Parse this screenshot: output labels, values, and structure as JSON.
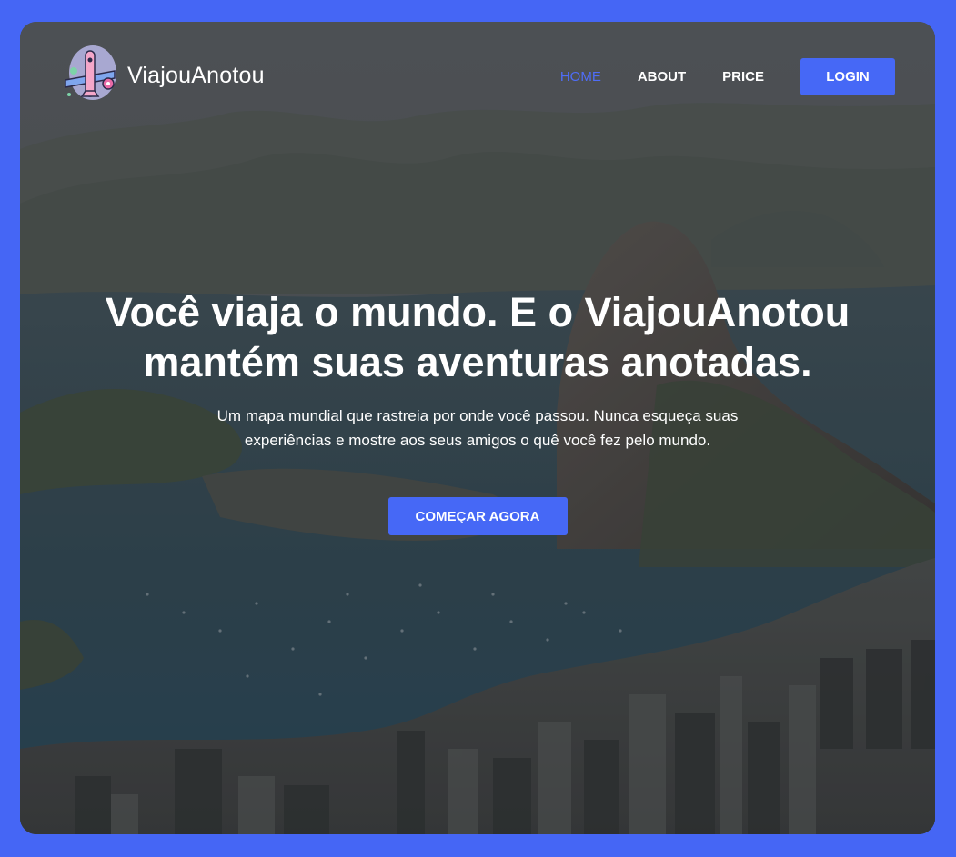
{
  "brand": {
    "name": "ViajouAnotou",
    "logo_icon": "airplane-logo-icon"
  },
  "nav": {
    "items": [
      {
        "label": "HOME",
        "active": true
      },
      {
        "label": "ABOUT",
        "active": false
      },
      {
        "label": "PRICE",
        "active": false
      }
    ],
    "login_label": "LOGIN"
  },
  "hero": {
    "title": "Você viaja o mundo. E o ViajouAnotou mantém suas aventuras anotadas.",
    "subtitle": "Um mapa mundial que rastreia por onde você passou. Nunca esqueça suas experiências e mostre aos seus amigos o quê você fez pelo mundo.",
    "cta_label": "COMEÇAR AGORA"
  },
  "colors": {
    "frame_background": "#4566f5",
    "accent": "#4668f6",
    "active_nav": "#4f6df6",
    "text": "#ffffff"
  }
}
